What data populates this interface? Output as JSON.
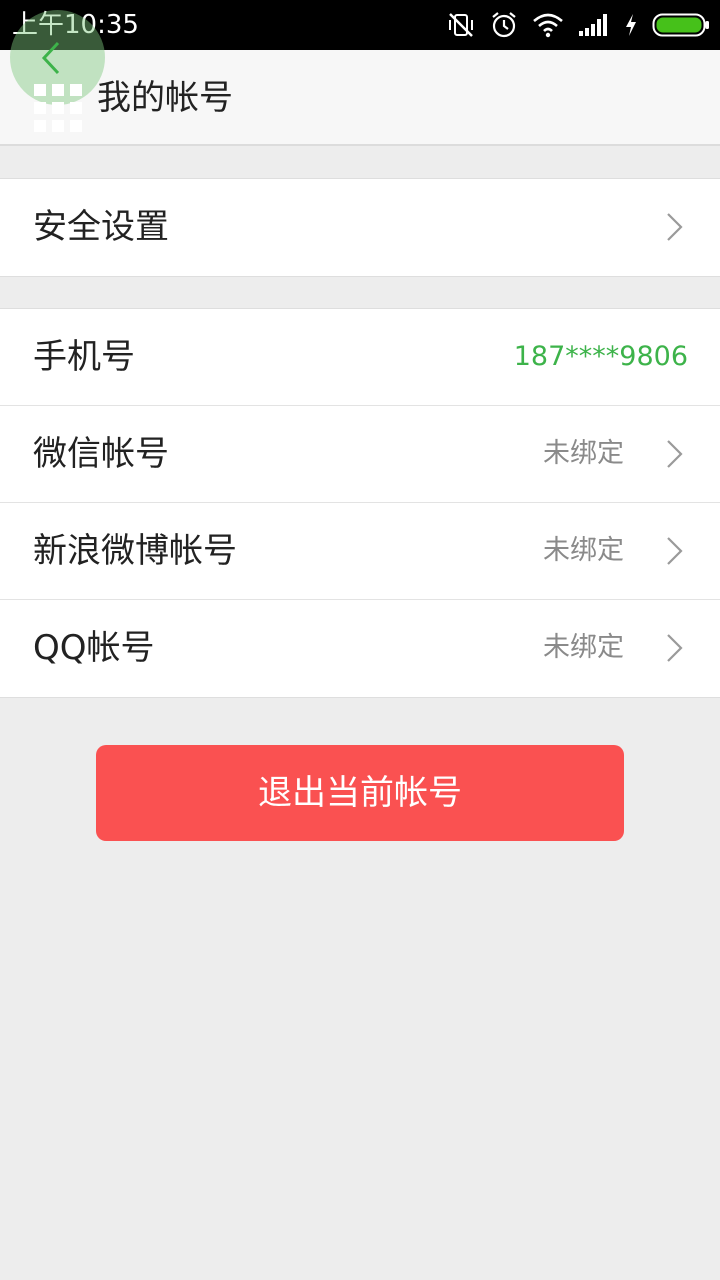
{
  "status_bar": {
    "time": "上午10:35",
    "icons": [
      "vibrate-off-icon",
      "alarm-icon",
      "wifi-icon",
      "signal-icon",
      "charging-icon",
      "battery-icon"
    ]
  },
  "header": {
    "title": "我的帐号",
    "back_icon": "back-arrow-icon",
    "overlay_icon": "apps-grid-icon"
  },
  "security": {
    "label": "安全设置"
  },
  "accounts": {
    "phone": {
      "label": "手机号",
      "value": "187****9806"
    },
    "wechat": {
      "label": "微信帐号",
      "value": "未绑定"
    },
    "weibo": {
      "label": "新浪微博帐号",
      "value": "未绑定"
    },
    "qq": {
      "label": "QQ帐号",
      "value": "未绑定"
    }
  },
  "logout_label": "退出当前帐号",
  "colors": {
    "accent_green": "#3db34a",
    "logout_red": "#fa5151",
    "background": "#ededed"
  }
}
